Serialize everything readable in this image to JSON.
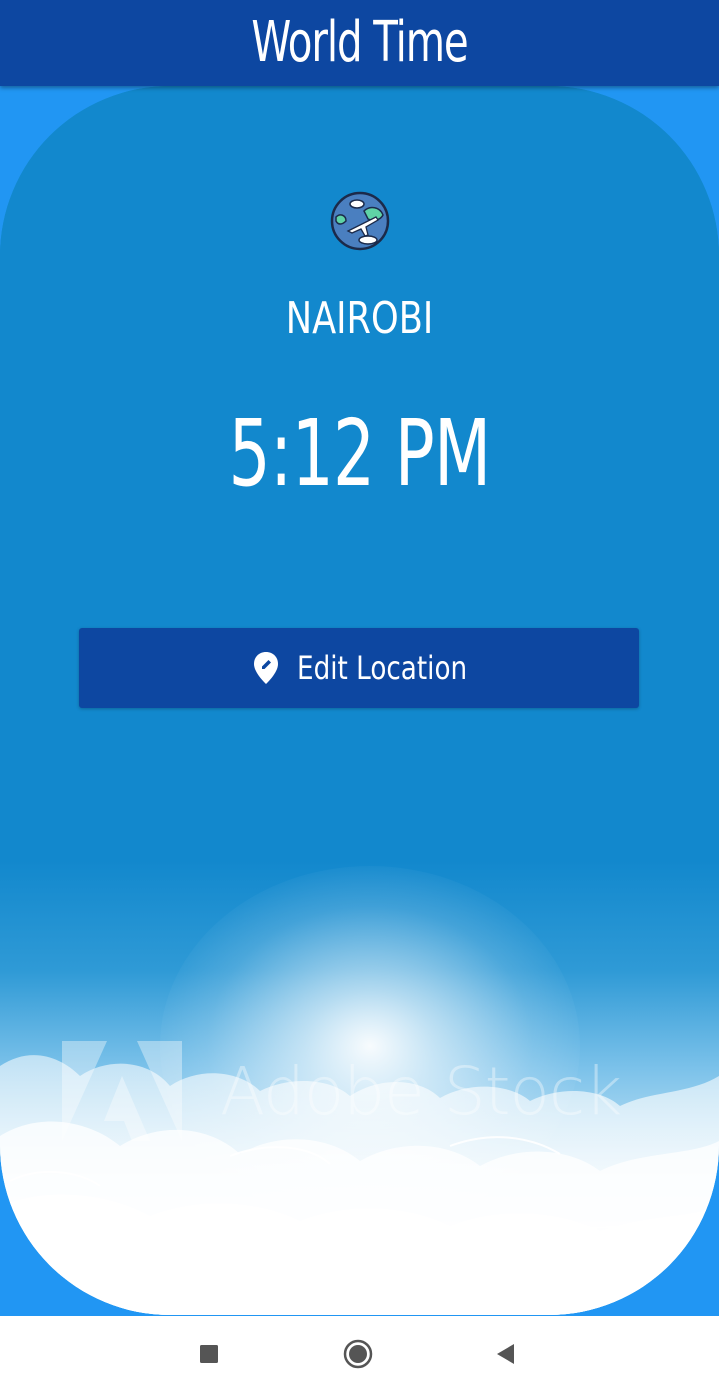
{
  "appbar": {
    "title": "World Time"
  },
  "location": {
    "city": "NAIROBI",
    "time": "5:12 PM",
    "flag_icon": "globe-airplane-icon"
  },
  "actions": {
    "edit_location_label": "Edit Location",
    "edit_location_icon": "location-pin-edit-icon"
  },
  "background": {
    "watermark_text": "Adobe Stock",
    "image": "sky-clouds-sunburst"
  },
  "navbar": {
    "recents_icon": "square-icon",
    "home_icon": "circle-icon",
    "back_icon": "triangle-back-icon"
  },
  "colors": {
    "appbar": "#0d47a1",
    "screen_background": "#2196f3",
    "card": "#1288cd",
    "button": "#0d47a1",
    "text": "#ffffff"
  }
}
